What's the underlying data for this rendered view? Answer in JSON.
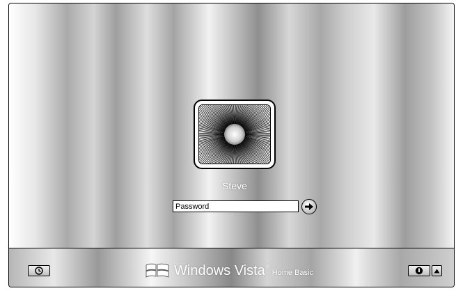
{
  "user": {
    "name": "Steve",
    "picture_icon": "flower-icon"
  },
  "password": {
    "placeholder": "Password",
    "value": ""
  },
  "submit": {
    "icon": "arrow-right-icon"
  },
  "taskbar": {
    "ease_of_access_icon": "ease-of-access-icon",
    "power_icon": "power-icon",
    "options_icon": "triangle-up-icon",
    "brand": {
      "logo_icon": "windows-flag-icon",
      "name": "Windows Vista",
      "registered": "®",
      "edition": "Home Basic"
    }
  },
  "colors": {
    "frame": "#000000",
    "text": "#ffffff"
  }
}
